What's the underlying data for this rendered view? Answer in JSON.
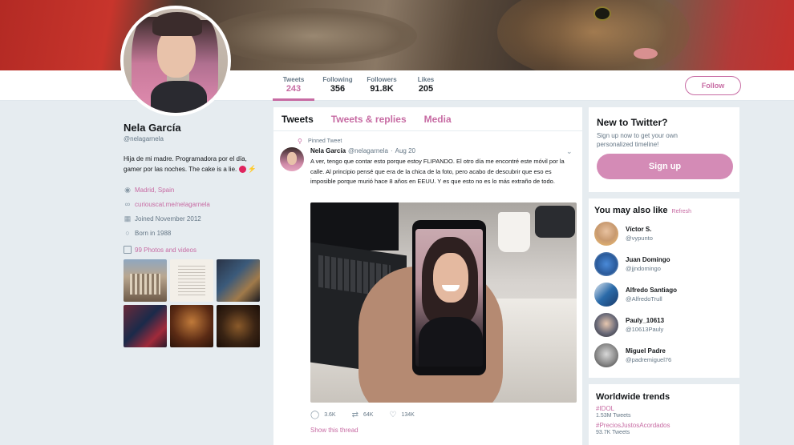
{
  "profile": {
    "name": "Nela García",
    "handle": "@nelagarnela",
    "bio": "Hija de mi madre. Programadora por el día, gamer por las noches. The cake is a lie.",
    "location": "Madrid, Spain",
    "link": "curiouscat.me/nelagarnela",
    "joined": "Joined November 2012",
    "born": "Born in 1988",
    "photos_label": "99 Photos and videos"
  },
  "stats": [
    {
      "label": "Tweets",
      "value": "243"
    },
    {
      "label": "Following",
      "value": "356"
    },
    {
      "label": "Followers",
      "value": "91.8K"
    },
    {
      "label": "Likes",
      "value": "205"
    }
  ],
  "follow_label": "Follow",
  "tabs": [
    "Tweets",
    "Tweets & replies",
    "Media"
  ],
  "tweet": {
    "pinned": "Pinned Tweet",
    "name": "Nela García",
    "handle": "@nelagarnela",
    "date": "Aug 20",
    "text": "A ver, tengo que contar esto porque estoy FLIPANDO. El otro día me encontré este móvil por la calle. Al principio pensé que era de la chica de la foto, pero acabo de descubrir que eso es imposible porque murió hace 8 años en EEUU. Y es que esto no es lo más extraño de todo.",
    "replies": "3.6K",
    "retweets": "64K",
    "likes": "134K",
    "show_thread": "Show this thread"
  },
  "new_to_twitter": {
    "title": "New to Twitter?",
    "subtitle": "Sign up now to get your own personalized timeline!",
    "button": "Sign up"
  },
  "who_to_follow": {
    "title": "You may also like",
    "refresh": "Refresh",
    "users": [
      {
        "name": "Víctor S.",
        "handle": "@vypunto"
      },
      {
        "name": "Juan Domingo",
        "handle": "@jjndomingo"
      },
      {
        "name": "Alfredo Santiago",
        "handle": "@AlfredoTrull"
      },
      {
        "name": "Pauly_10613",
        "handle": "@10613Pauly"
      },
      {
        "name": "Miguel Padre",
        "handle": "@padremiguel76"
      }
    ]
  },
  "trends": {
    "title": "Worldwide trends",
    "items": [
      {
        "name": "#IDOL",
        "count": "1.53M Tweets"
      },
      {
        "name": "#PreciosJustosAcordados",
        "count": "93.7K Tweets"
      }
    ]
  },
  "colors": {
    "accent": "#c76ba3",
    "signup": "#d48bb6"
  }
}
